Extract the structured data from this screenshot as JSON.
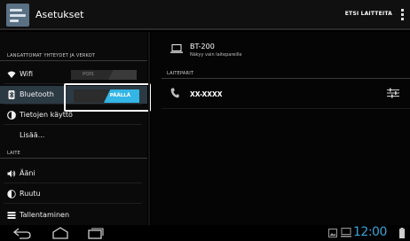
{
  "actionbar": {
    "title": "Asetukset",
    "search_devices": "ETSI LAITTEITA",
    "app_icon": "settings-app-icon",
    "overflow_icon": "overflow-menu-icon"
  },
  "sidebar": {
    "section_wireless": "LANGATTOMAT YHTEYDET JA VERKOT",
    "section_device": "LAITE",
    "items": [
      {
        "label": "Wifi",
        "icon": "wifi-icon",
        "toggle": "POIS"
      },
      {
        "label": "Bluetooth",
        "icon": "bluetooth-icon",
        "toggle": "PÄÄLLÄ"
      },
      {
        "label": "Tietojen käyttö",
        "icon": "data-usage-icon"
      },
      {
        "label": "Lisää...",
        "icon": ""
      },
      {
        "label": "Ääni",
        "icon": "sound-icon"
      },
      {
        "label": "Ruutu",
        "icon": "display-icon"
      },
      {
        "label": "Tallentaminen",
        "icon": "storage-icon"
      }
    ]
  },
  "device": {
    "name": "BT-200",
    "visibility": "Näkyy vain laitepareille",
    "icon": "laptop-icon"
  },
  "paired": {
    "header": "LAITEPARIT",
    "items": [
      {
        "name": "XX-XXXX",
        "icon": "phone-icon",
        "settings_icon": "tune-settings-icon"
      }
    ]
  },
  "navbar": {
    "clock": "12:00",
    "back_icon": "back-icon",
    "home_icon": "home-icon",
    "recents_icon": "recents-icon",
    "gallery_icon": "gallery-notification-icon",
    "device_icon": "device-notification-icon",
    "battery_icon": "battery-icon"
  },
  "colors": {
    "accent": "#33b5e5",
    "selected_row": "#2c3a44",
    "clock": "#3aa3d6"
  }
}
